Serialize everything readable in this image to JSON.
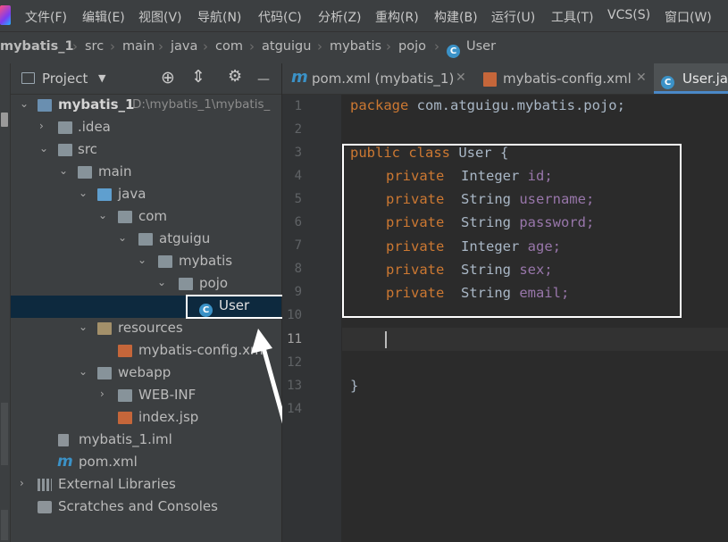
{
  "menu": [
    "文件(F)",
    "编辑(E)",
    "视图(V)",
    "导航(N)",
    "代码(C)",
    "分析(Z)",
    "重构(R)",
    "构建(B)",
    "运行(U)",
    "工具(T)",
    "VCS(S)",
    "窗口(W)"
  ],
  "breadcrumb": [
    "mybatis_1",
    "src",
    "main",
    "java",
    "com",
    "atguigu",
    "mybatis",
    "pojo",
    "User"
  ],
  "project_panel": {
    "title": "Project"
  },
  "tree": [
    {
      "label": "mybatis_1",
      "extra": "D:\\mybatis_1\\mybatis_"
    },
    {
      "label": ".idea"
    },
    {
      "label": "src"
    },
    {
      "label": "main"
    },
    {
      "label": "java"
    },
    {
      "label": "com"
    },
    {
      "label": "atguigu"
    },
    {
      "label": "mybatis"
    },
    {
      "label": "pojo"
    },
    {
      "label": "User"
    },
    {
      "label": "resources"
    },
    {
      "label": "mybatis-config.xml"
    },
    {
      "label": "webapp"
    },
    {
      "label": "WEB-INF"
    },
    {
      "label": "index.jsp"
    },
    {
      "label": "mybatis_1.iml"
    },
    {
      "label": "pom.xml"
    },
    {
      "label": "External Libraries"
    },
    {
      "label": "Scratches and Consoles"
    }
  ],
  "tabs": [
    "pom.xml (mybatis_1)",
    "mybatis-config.xml",
    "User.ja"
  ],
  "line_numbers": [
    "1",
    "2",
    "3",
    "4",
    "5",
    "6",
    "7",
    "8",
    "9",
    "10",
    "11",
    "12",
    "13",
    "14"
  ],
  "code": {
    "line1_kw": "package",
    "line1_rest": " com.atguigu.mybatis.pojo;",
    "class_kw": "public class",
    "class_name": " User {",
    "fields": [
      {
        "mod": "private",
        "type": "  Integer",
        "name": " id;"
      },
      {
        "mod": "private",
        "type": "  String",
        "name": " username;"
      },
      {
        "mod": "private",
        "type": "  String",
        "name": " password;"
      },
      {
        "mod": "private",
        "type": "  Integer",
        "name": " age;"
      },
      {
        "mod": "private",
        "type": "  String",
        "name": " sex;"
      },
      {
        "mod": "private",
        "type": "  String",
        "name": " email;"
      }
    ],
    "close": "}"
  },
  "colors": {
    "keyword": "#cc7832",
    "field": "#9876aa",
    "text": "#a9b7c6",
    "accent_class_icon": "#3b92c7",
    "selection": "#0d293e"
  },
  "icons": [
    "project-icon",
    "target-icon",
    "collapse-icon",
    "gear-icon",
    "class-icon",
    "maven-icon",
    "xml-icon",
    "jsp-icon",
    "folder-icon",
    "library-icon",
    "scratches-icon"
  ]
}
